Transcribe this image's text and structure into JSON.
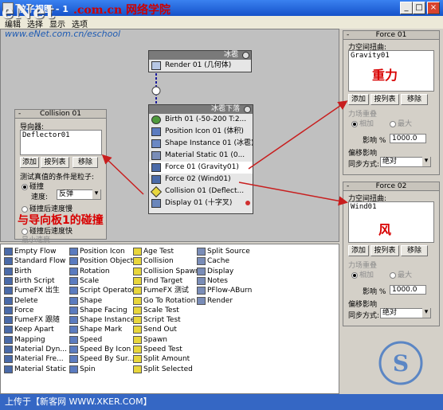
{
  "window": {
    "title": "粒子视图 - 1",
    "minimize": "_",
    "maximize": "□",
    "close": "×"
  },
  "watermark": {
    "brand": "eNet",
    "cn": ".com.cn 网络学院",
    "url": "www.eNet.com.cn/eschool"
  },
  "menu": [
    "编辑",
    "选择",
    "显示",
    "选项"
  ],
  "nodes": {
    "render_node": {
      "header": "冰雹",
      "rows": [
        {
          "label": "Render 01 (几何体)"
        }
      ]
    },
    "flow_node": {
      "header": "冰雹下落",
      "rows": [
        {
          "label": "Birth 01 (-50-200 T:2..."
        },
        {
          "label": "Position Icon 01 (体积)"
        },
        {
          "label": "Shape Instance 01 (冰雹)"
        },
        {
          "label": "Material Static 01 (0..."
        },
        {
          "label": "Force 01 (Gravity01)"
        },
        {
          "label": "Force 02 (Wind01)"
        },
        {
          "label": "Collision 01 (Deflect..."
        },
        {
          "label": "Display 01 (十字叉)"
        }
      ]
    }
  },
  "collision_rollout": {
    "header": "Collision 01",
    "deflectors_label": "导向器:",
    "list_item": "Deflector01",
    "add": "添加",
    "by_list": "按列表",
    "remove": "移除",
    "test_label": "测试真值的条件是粒子:",
    "opt_bounce": "碰撞",
    "speed_label": "速度:",
    "speed_value": "反弹",
    "opt_slow": "碰撞后速度慢",
    "opt_fast": "碰撞后速度快",
    "cut_label": "最小速度"
  },
  "annotation": "与导向板1的碰撞",
  "force01": {
    "header": "Force 01",
    "space_warps_label": "力空间扭曲:",
    "list_item": "Gravity01",
    "note": "重力",
    "add": "添加",
    "by_list": "按列表",
    "remove": "移除",
    "overlap_label": "力场重叠",
    "opt_add": "相加",
    "opt_max": "最大",
    "influence_label": "影响 %",
    "influence_value": "1000.0",
    "offset_label": "偏移影响",
    "sync_label": "同步方式:",
    "sync_value": "绝对"
  },
  "force02": {
    "header": "Force 02",
    "space_warps_label": "力空间扭曲:",
    "list_item": "Wind01",
    "note": "风",
    "add": "添加",
    "by_list": "按列表",
    "remove": "移除",
    "overlap_label": "力场重叠",
    "opt_add": "相加",
    "opt_max": "最大",
    "influence_label": "影响 %",
    "influence_value": "1000.0",
    "offset_label": "偏移影响",
    "sync_label": "同步方式:",
    "sync_value": "绝对"
  },
  "depot": {
    "col1": [
      "Empty Flow",
      "Standard Flow",
      "Birth",
      "Birth Script",
      "FumeFX 出生",
      "Delete",
      "Force",
      "FumeFX 跟随",
      "Keep Apart",
      "Mapping",
      "Material Dyn...",
      "Material Fre...",
      "Material Static"
    ],
    "col2": [
      "Position Icon",
      "Position Object",
      "Rotation",
      "Scale",
      "Script Operator",
      "Shape",
      "Shape Facing",
      "Shape Instance",
      "Shape Mark",
      "Speed",
      "Speed By Icon",
      "Speed By Sur...",
      "Spin"
    ],
    "col3": [
      "Age Test",
      "Collision",
      "Collision Spawn",
      "Find Target",
      "FumeFX 测试",
      "Go To Rotation",
      "Scale Test",
      "Script Test",
      "Send Out",
      "Spawn",
      "Speed Test",
      "Split Amount",
      "Split Selected"
    ],
    "col4": [
      "Split Source",
      "Cache",
      "Display",
      "Notes",
      "PFlow-ABurn",
      "Render"
    ]
  },
  "status": "上传于【新客网 WWW.XKER.COM】",
  "colors": {
    "arrow": "#c81e1e",
    "titlebar": "#2a68e0"
  }
}
